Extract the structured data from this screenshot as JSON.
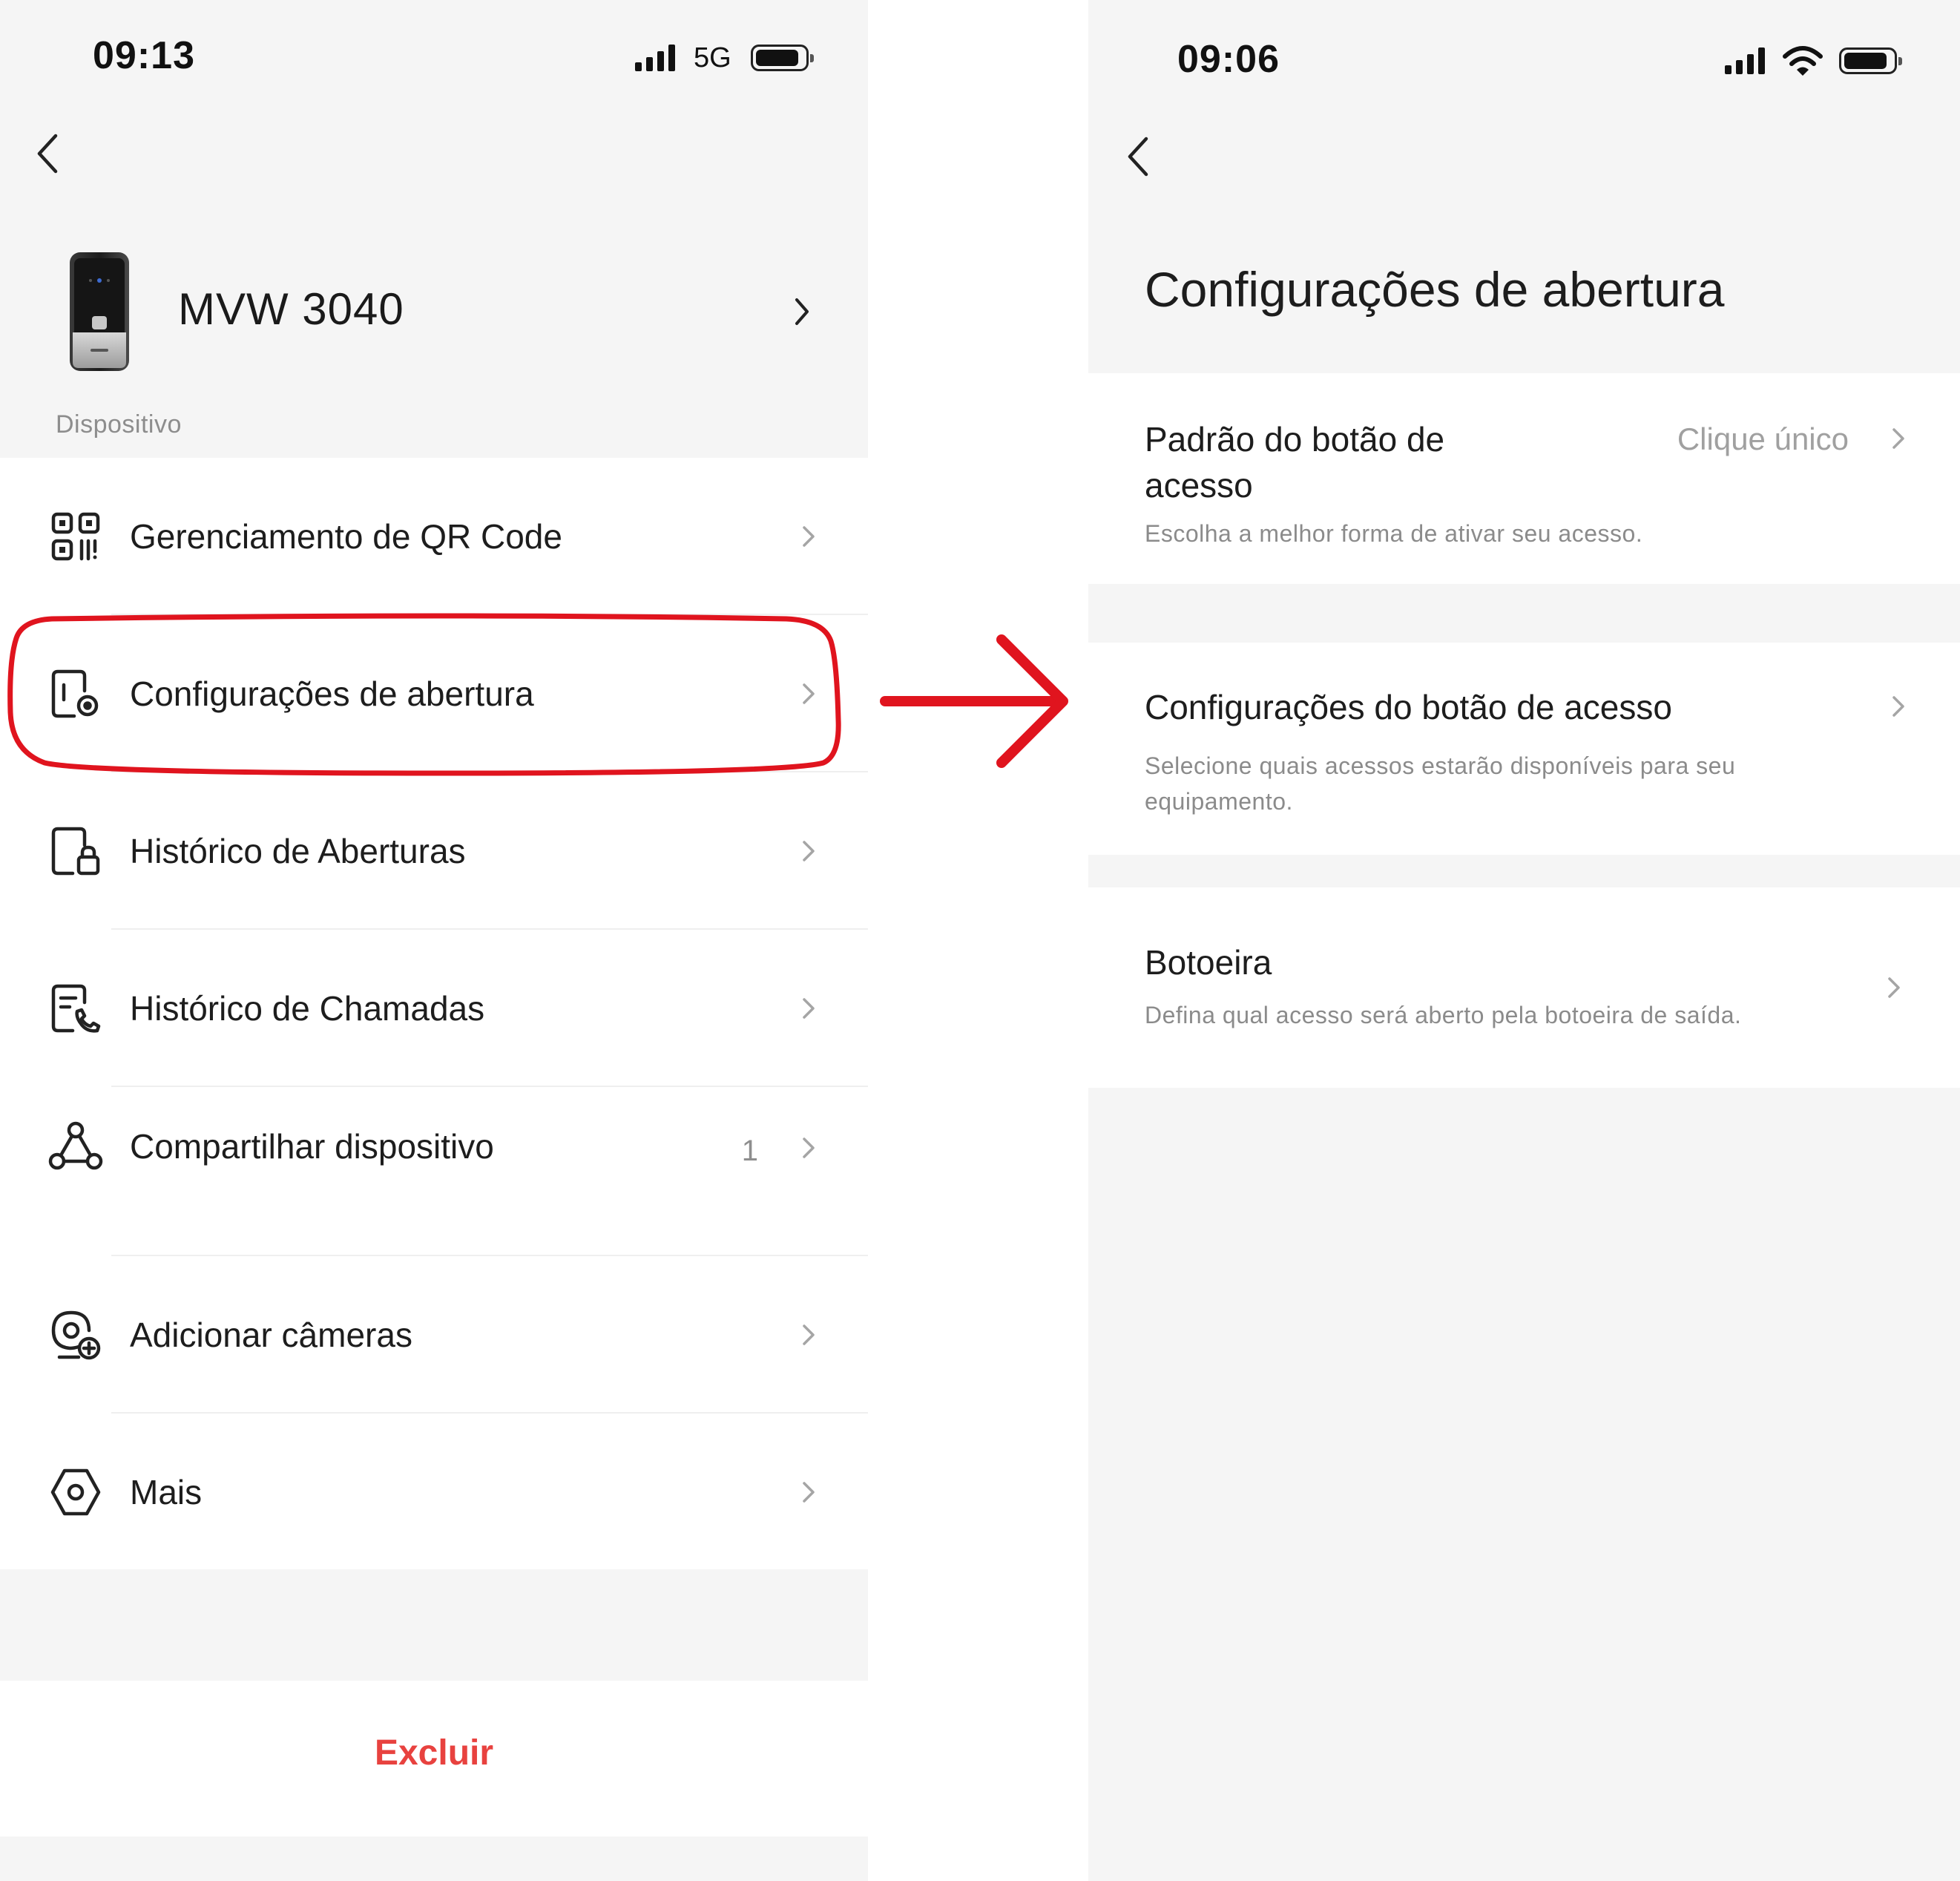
{
  "left_screen": {
    "status": {
      "time": "09:13",
      "network": "5G"
    },
    "device": {
      "name": "MVW 3040",
      "section_label": "Dispositivo"
    },
    "menu": [
      {
        "label": "Gerenciamento de QR Code",
        "icon": "qr-code-icon"
      },
      {
        "label": "Configurações de abertura",
        "icon": "door-lock-settings-icon",
        "highlighted": true
      },
      {
        "label": "Histórico de Aberturas",
        "icon": "door-lock-history-icon"
      },
      {
        "label": "Histórico de Chamadas",
        "icon": "call-history-icon"
      },
      {
        "label": "Compartilhar dispositivo",
        "icon": "share-icon",
        "count": "1"
      },
      {
        "label": "Adicionar câmeras",
        "icon": "add-camera-icon"
      },
      {
        "label": "Mais",
        "icon": "hexagon-settings-icon"
      }
    ],
    "delete_label": "Excluir"
  },
  "right_screen": {
    "status": {
      "time": "09:06"
    },
    "page_title": "Configurações de abertura",
    "items": [
      {
        "title": "Padrão do botão de acesso",
        "value": "Clique único",
        "subtitle": "Escolha a melhor forma de ativar seu acesso."
      },
      {
        "title": "Configurações do botão de acesso",
        "subtitle": "Selecione quais acessos estarão disponíveis para seu equipamento."
      },
      {
        "title": "Botoeira",
        "subtitle": "Defina qual acesso será aberto pela botoeira de saída."
      }
    ]
  },
  "annotation": {
    "highlight_color": "#e0141e",
    "arrow": "right-arrow"
  },
  "colors": {
    "danger": "#e8423f",
    "background": "#f5f5f5",
    "card": "#ffffff"
  }
}
